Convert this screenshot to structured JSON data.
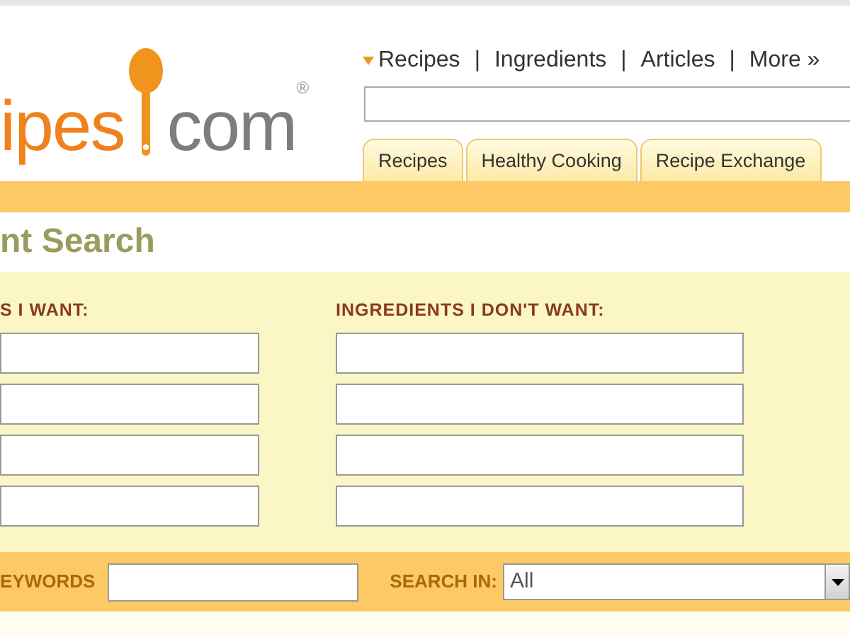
{
  "logo": {
    "text_left": "ipes",
    "text_right": "com",
    "mark": "®"
  },
  "top_nav": [
    {
      "label": "Recipes"
    },
    {
      "label": "Ingredients"
    },
    {
      "label": "Articles"
    },
    {
      "label": "More »"
    }
  ],
  "nav_separator": "|",
  "tabs": [
    {
      "label": "Recipes"
    },
    {
      "label": "Healthy Cooking"
    },
    {
      "label": "Recipe Exchange"
    }
  ],
  "page_title": "nt Search",
  "columns": [
    {
      "heading": "S I WANT:"
    },
    {
      "heading": "INGREDIENTS I DON'T WANT:"
    }
  ],
  "bottom_bar": {
    "keywords_label": "EYWORDS",
    "search_in_label": "SEARCH IN:",
    "search_in_value": "All"
  }
}
